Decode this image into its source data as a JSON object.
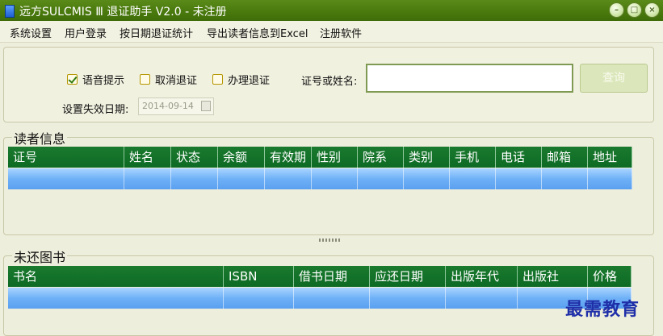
{
  "window": {
    "title": "远方SULCMIS Ⅲ 退证助手 V2.0 - 未注册"
  },
  "menu": {
    "items": [
      "系统设置",
      "用户登录",
      "按日期退证统计",
      "导出读者信息到Excel",
      "注册软件"
    ]
  },
  "query": {
    "checkboxes": [
      {
        "label": "语音提示",
        "checked": true
      },
      {
        "label": "取消退证",
        "checked": false
      },
      {
        "label": "办理退证",
        "checked": false
      }
    ],
    "search_label": "证号或姓名:",
    "search_value": "",
    "query_button": "查询",
    "expire_label": "设置失效日期:",
    "expire_date": "2014-09-14"
  },
  "reader_info": {
    "title": "读者信息",
    "columns": [
      "证号",
      "姓名",
      "状态",
      "余额",
      "有效期",
      "性别",
      "院系",
      "类别",
      "手机",
      "电话",
      "邮箱",
      "地址"
    ]
  },
  "unreturned_books": {
    "title": "未还图书",
    "columns": [
      "书名",
      "ISBN",
      "借书日期",
      "应还日期",
      "出版年代",
      "出版社",
      "价格"
    ]
  },
  "watermark": "最需教育",
  "colors": {
    "titlebar": "#4a7a0e",
    "grid_header": "#0d6a24",
    "selected_row": "#6fb1f7",
    "background": "#eeeedc"
  }
}
